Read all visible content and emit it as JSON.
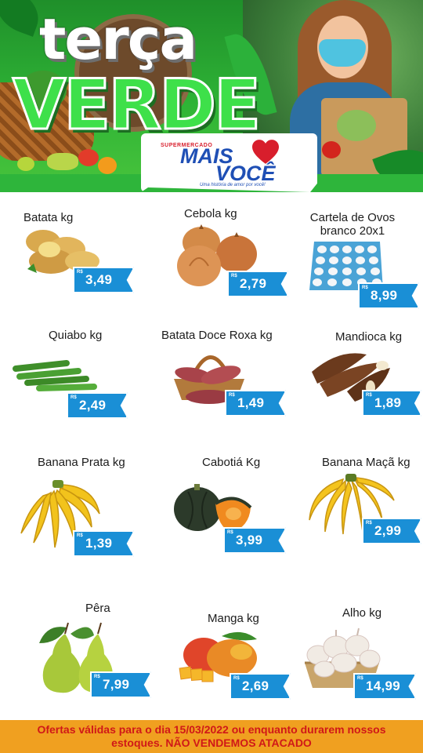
{
  "header": {
    "title_line1": "terça",
    "title_line2": "VERDE",
    "logo": {
      "small": "SUPERMERCADO",
      "brand_mais": "MAIS",
      "brand_voce": "VOCÊ",
      "tagline": "Uma história de amor por você!"
    }
  },
  "products": [
    {
      "name": "Batata kg",
      "currency": "R$",
      "price": "3,49",
      "icon": "potato-icon"
    },
    {
      "name": "Cebola kg",
      "currency": "R$",
      "price": "2,79",
      "icon": "onion-icon"
    },
    {
      "name": "Cartela de Ovos\nbranco 20x1",
      "currency": "R$",
      "price": "8,99",
      "icon": "egg-tray-icon"
    },
    {
      "name": "Quiabo kg",
      "currency": "R$",
      "price": "2,49",
      "icon": "okra-icon"
    },
    {
      "name": "Batata Doce Roxa kg",
      "currency": "R$",
      "price": "1,49",
      "icon": "sweet-potato-icon"
    },
    {
      "name": "Mandioca kg",
      "currency": "R$",
      "price": "1,89",
      "icon": "cassava-icon"
    },
    {
      "name": "Banana Prata kg",
      "currency": "R$",
      "price": "1,39",
      "icon": "banana-icon"
    },
    {
      "name": "Cabotiá Kg",
      "currency": "R$",
      "price": "3,99",
      "icon": "pumpkin-icon"
    },
    {
      "name": "Banana Maçã kg",
      "currency": "R$",
      "price": "2,99",
      "icon": "banana-icon"
    },
    {
      "name": "Pêra",
      "currency": "R$",
      "price": "7,99",
      "icon": "pear-icon"
    },
    {
      "name": "Manga kg",
      "currency": "R$",
      "price": "2,69",
      "icon": "mango-icon"
    },
    {
      "name": "Alho kg",
      "currency": "R$",
      "price": "14,99",
      "icon": "garlic-icon"
    }
  ],
  "footer": {
    "text": "Ofertas válidas para o dia 15/03/2022 ou enquanto durarem nossos estoques. NÃO VENDEMOS ATACADO"
  },
  "colors": {
    "header_green": "#2fb436",
    "price_blue": "#1a8fd6",
    "brand_blue": "#1f4fb5",
    "brand_red": "#d81e2c",
    "footer_orange": "#f0a020",
    "footer_text_red": "#d01818"
  }
}
